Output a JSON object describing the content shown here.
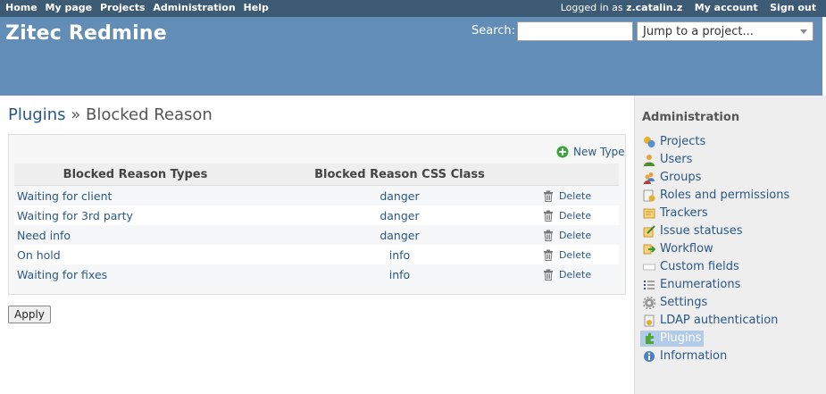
{
  "top_menu": {
    "items": [
      {
        "label": "Home"
      },
      {
        "label": "My page"
      },
      {
        "label": "Projects"
      },
      {
        "label": "Administration"
      },
      {
        "label": "Help"
      }
    ],
    "logged_in_prefix": "Logged in as",
    "username": "z.catalin.z",
    "my_account": "My account",
    "sign_out": "Sign out"
  },
  "header": {
    "title": "Zitec Redmine",
    "search_label": "Search:",
    "search_value": "",
    "jump_label": "Jump to a project..."
  },
  "page": {
    "breadcrumb_link": "Plugins",
    "breadcrumb_sep": "»",
    "title": "Blocked Reason",
    "new_type": "New Type",
    "columns": [
      "Blocked Reason Types",
      "Blocked Reason CSS Class"
    ],
    "rows": [
      {
        "name": "Waiting for client",
        "css": "danger",
        "action": "Delete"
      },
      {
        "name": "Waiting for 3rd party",
        "css": "danger",
        "action": "Delete"
      },
      {
        "name": "Need info",
        "css": "danger",
        "action": "Delete"
      },
      {
        "name": "On hold",
        "css": "info",
        "action": "Delete"
      },
      {
        "name": "Waiting for fixes",
        "css": "info",
        "action": "Delete"
      }
    ],
    "apply": "Apply"
  },
  "sidebar": {
    "title": "Administration",
    "items": [
      {
        "label": "Projects",
        "icon": "projects-icon"
      },
      {
        "label": "Users",
        "icon": "user-icon"
      },
      {
        "label": "Groups",
        "icon": "group-icon"
      },
      {
        "label": "Roles and permissions",
        "icon": "roles-icon"
      },
      {
        "label": "Trackers",
        "icon": "tracker-icon"
      },
      {
        "label": "Issue statuses",
        "icon": "issue-status-icon"
      },
      {
        "label": "Workflow",
        "icon": "workflow-icon"
      },
      {
        "label": "Custom fields",
        "icon": "custom-fields-icon"
      },
      {
        "label": "Enumerations",
        "icon": "list-icon"
      },
      {
        "label": "Settings",
        "icon": "gear-icon"
      },
      {
        "label": "LDAP authentication",
        "icon": "ldap-icon"
      },
      {
        "label": "Plugins",
        "icon": "plugin-icon",
        "selected": true
      },
      {
        "label": "Information",
        "icon": "info-icon"
      }
    ]
  }
}
